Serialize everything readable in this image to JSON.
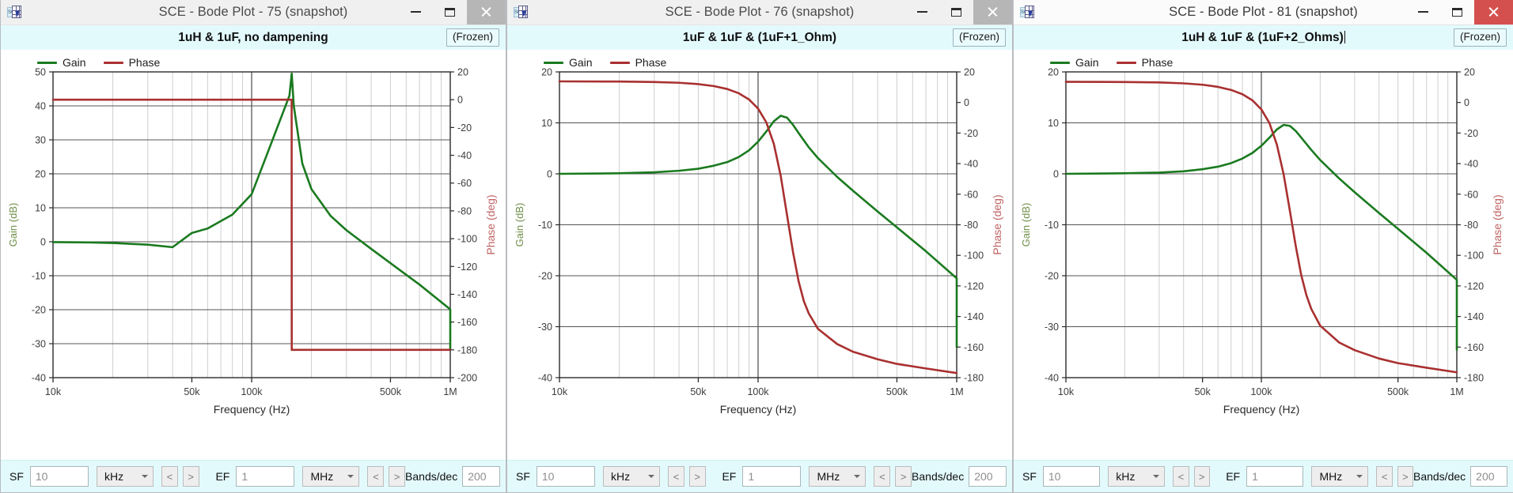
{
  "colors": {
    "gain": "#1a7a1f",
    "phase": "#a93030",
    "gain_axis_label": "#6f8f4a",
    "phase_axis_label": "#c06464",
    "caption_band": "#e3fafd",
    "close_active": "#d4504f",
    "close_inactive": "#b6b6b6",
    "grid_major": "#555555",
    "grid_minor": "#cfcfcf"
  },
  "windows": [
    {
      "id": "window-75",
      "title": "SCE - Bode Plot - 75  (snapshot)",
      "caption": "1uH & 1uF, no dampening",
      "caption_has_caret": false,
      "active": false,
      "frozen_label": "(Frozen)",
      "controls": {
        "minimize": "Minimize",
        "maximize": "Maximize",
        "close": "Close"
      },
      "legend": [
        {
          "label": "Gain",
          "color": "#1a7a1f"
        },
        {
          "label": "Phase",
          "color": "#a93030"
        }
      ],
      "toolbar": {
        "sf_label": "SF",
        "sf_value": "10",
        "sf_unit": "kHz",
        "sf_prev": "<",
        "sf_next": ">",
        "ef_label": "EF",
        "ef_value": "1",
        "ef_unit": "MHz",
        "ef_prev": "<",
        "ef_next": ">",
        "bands_label": "Bands/dec",
        "bands_value": "200"
      },
      "chart_data": {
        "type": "line",
        "title": "1uH & 1uF, no dampening",
        "xlabel": "Frequency (Hz)",
        "ylabel": "Gain (dB)",
        "y2label": "Phase (deg)",
        "xscale": "log",
        "xlim": [
          10000,
          1000000
        ],
        "xticks": [
          10000,
          50000,
          100000,
          500000,
          1000000
        ],
        "xticklabels": [
          "10k",
          "50k",
          "100k",
          "500k",
          "1M"
        ],
        "ylim": [
          -40,
          50
        ],
        "yticks": [
          -40,
          -30,
          -20,
          -10,
          0,
          10,
          20,
          30,
          40,
          50
        ],
        "y2lim": [
          -200,
          20
        ],
        "y2ticks": [
          -200,
          -180,
          -160,
          -140,
          -120,
          -100,
          -80,
          -60,
          -40,
          -20,
          0,
          20
        ],
        "grid": true,
        "legend_position": "top-left",
        "model": {
          "kind": "lc_undamped",
          "L_uH": 1,
          "C_uF": 1,
          "R_ohm": 0
        },
        "series": [
          {
            "name": "Gain",
            "color": "#1a7a1f",
            "axis": "left",
            "points": [
              [
                10000,
                -0.09
              ],
              [
                15000,
                -0.2
              ],
              [
                20000,
                -0.37
              ],
              [
                30000,
                -0.86
              ],
              [
                40000,
                -1.6
              ],
              [
                50000,
                2.6
              ],
              [
                60000,
                3.9
              ],
              [
                80000,
                8.0
              ],
              [
                100000,
                14.0
              ],
              [
                120000,
                26.0
              ],
              [
                155000,
                43.0
              ],
              [
                159155,
                49.5
              ],
              [
                163000,
                40.0
              ],
              [
                180000,
                23.0
              ],
              [
                200000,
                15.5
              ],
              [
                250000,
                7.6
              ],
              [
                300000,
                3.4
              ],
              [
                400000,
                -2.1
              ],
              [
                500000,
                -6.3
              ],
              [
                700000,
                -12.6
              ],
              [
                1000000,
                -19.9
              ],
              [
                1000000,
                -31.5
              ]
            ]
          },
          {
            "name": "Phase",
            "color": "#a93030",
            "axis": "right",
            "points": [
              [
                10000,
                0
              ],
              [
                159000,
                0
              ],
              [
                159200,
                -180
              ],
              [
                1000000,
                -180
              ]
            ]
          }
        ]
      }
    },
    {
      "id": "window-76",
      "title": "SCE - Bode Plot - 76  (snapshot)",
      "caption": "1uF & 1uF & (1uF+1_Ohm)",
      "caption_has_caret": false,
      "active": false,
      "frozen_label": "(Frozen)",
      "controls": {
        "minimize": "Minimize",
        "maximize": "Maximize",
        "close": "Close"
      },
      "legend": [
        {
          "label": "Gain",
          "color": "#1a7a1f"
        },
        {
          "label": "Phase",
          "color": "#a93030"
        }
      ],
      "toolbar": {
        "sf_label": "SF",
        "sf_value": "10",
        "sf_unit": "kHz",
        "sf_prev": "<",
        "sf_next": ">",
        "ef_label": "EF",
        "ef_value": "1",
        "ef_unit": "MHz",
        "ef_prev": "<",
        "ef_next": ">",
        "bands_label": "Bands/dec",
        "bands_value": "200"
      },
      "chart_data": {
        "type": "line",
        "title": "1uF & 1uF & (1uF+1_Ohm)",
        "xlabel": "Frequency (Hz)",
        "ylabel": "Gain (dB)",
        "y2label": "Phase (deg)",
        "xscale": "log",
        "xlim": [
          10000,
          1000000
        ],
        "xticks": [
          10000,
          50000,
          100000,
          500000,
          1000000
        ],
        "xticklabels": [
          "10k",
          "50k",
          "100k",
          "500k",
          "1M"
        ],
        "ylim": [
          -40,
          20
        ],
        "yticks": [
          -40,
          -30,
          -20,
          -10,
          0,
          10,
          20
        ],
        "y2lim": [
          -180,
          20
        ],
        "y2ticks": [
          -180,
          -160,
          -140,
          -120,
          -100,
          -80,
          -60,
          -40,
          -20,
          0,
          20
        ],
        "grid": true,
        "legend_position": "top-left",
        "model": {
          "kind": "lc_damped",
          "L_uH": 1,
          "C_uF": 1,
          "R_ohm": 1
        },
        "series": [
          {
            "name": "Gain",
            "color": "#1a7a1f",
            "axis": "left",
            "points": [
              [
                10000,
                0.0
              ],
              [
                20000,
                0.1
              ],
              [
                30000,
                0.3
              ],
              [
                40000,
                0.6
              ],
              [
                50000,
                1.0
              ],
              [
                60000,
                1.6
              ],
              [
                70000,
                2.3
              ],
              [
                80000,
                3.3
              ],
              [
                90000,
                4.6
              ],
              [
                100000,
                6.3
              ],
              [
                110000,
                8.3
              ],
              [
                120000,
                10.3
              ],
              [
                130000,
                11.4
              ],
              [
                140000,
                11.0
              ],
              [
                150000,
                9.6
              ],
              [
                160000,
                8.0
              ],
              [
                180000,
                5.2
              ],
              [
                200000,
                3.1
              ],
              [
                250000,
                -0.6
              ],
              [
                300000,
                -3.3
              ],
              [
                400000,
                -7.4
              ],
              [
                500000,
                -10.5
              ],
              [
                700000,
                -15.2
              ],
              [
                1000000,
                -20.5
              ],
              [
                1000000,
                -34.0
              ]
            ]
          },
          {
            "name": "Phase",
            "color": "#a93030",
            "axis": "right",
            "points": [
              [
                10000,
                13.8
              ],
              [
                20000,
                13.7
              ],
              [
                30000,
                13.4
              ],
              [
                40000,
                12.9
              ],
              [
                50000,
                12.0
              ],
              [
                60000,
                10.7
              ],
              [
                70000,
                8.8
              ],
              [
                80000,
                6.0
              ],
              [
                90000,
                2.0
              ],
              [
                100000,
                -4.0
              ],
              [
                110000,
                -13.0
              ],
              [
                120000,
                -27.0
              ],
              [
                130000,
                -48.0
              ],
              [
                140000,
                -74.0
              ],
              [
                150000,
                -98.0
              ],
              [
                160000,
                -117.0
              ],
              [
                170000,
                -130.0
              ],
              [
                180000,
                -138.0
              ],
              [
                200000,
                -148.0
              ],
              [
                250000,
                -158.0
              ],
              [
                300000,
                -163.0
              ],
              [
                400000,
                -168.0
              ],
              [
                500000,
                -171.0
              ],
              [
                700000,
                -174.0
              ],
              [
                1000000,
                -177.0
              ]
            ]
          }
        ]
      }
    },
    {
      "id": "window-81",
      "title": "SCE - Bode Plot - 81  (snapshot)",
      "caption": "1uH & 1uF & (1uF+2_Ohms)",
      "caption_has_caret": true,
      "active": true,
      "frozen_label": "(Frozen)",
      "controls": {
        "minimize": "Minimize",
        "maximize": "Maximize",
        "close": "Close"
      },
      "legend": [
        {
          "label": "Gain",
          "color": "#1a7a1f"
        },
        {
          "label": "Phase",
          "color": "#a93030"
        }
      ],
      "toolbar": {
        "sf_label": "SF",
        "sf_value": "10",
        "sf_unit": "kHz",
        "sf_prev": "<",
        "sf_next": ">",
        "ef_label": "EF",
        "ef_value": "1",
        "ef_unit": "MHz",
        "ef_prev": "<",
        "ef_next": ">",
        "bands_label": "Bands/dec",
        "bands_value": "200"
      },
      "chart_data": {
        "type": "line",
        "title": "1uH & 1uF & (1uF+2_Ohms)",
        "xlabel": "Frequency (Hz)",
        "ylabel": "Gain (dB)",
        "y2label": "Phase (deg)",
        "xscale": "log",
        "xlim": [
          10000,
          1000000
        ],
        "xticks": [
          10000,
          50000,
          100000,
          500000,
          1000000
        ],
        "xticklabels": [
          "10k",
          "50k",
          "100k",
          "500k",
          "1M"
        ],
        "ylim": [
          -40,
          20
        ],
        "yticks": [
          -40,
          -30,
          -20,
          -10,
          0,
          10,
          20
        ],
        "y2lim": [
          -180,
          20
        ],
        "y2ticks": [
          -180,
          -160,
          -140,
          -120,
          -100,
          -80,
          -60,
          -40,
          -20,
          0,
          20
        ],
        "grid": true,
        "legend_position": "top-left",
        "model": {
          "kind": "lc_damped",
          "L_uH": 1,
          "C_uF": 1,
          "R_ohm": 2
        },
        "series": [
          {
            "name": "Gain",
            "color": "#1a7a1f",
            "axis": "left",
            "points": [
              [
                10000,
                0.0
              ],
              [
                20000,
                0.1
              ],
              [
                30000,
                0.25
              ],
              [
                40000,
                0.5
              ],
              [
                50000,
                0.9
              ],
              [
                60000,
                1.4
              ],
              [
                70000,
                2.1
              ],
              [
                80000,
                3.0
              ],
              [
                90000,
                4.1
              ],
              [
                100000,
                5.5
              ],
              [
                110000,
                7.1
              ],
              [
                120000,
                8.7
              ],
              [
                130000,
                9.6
              ],
              [
                140000,
                9.4
              ],
              [
                150000,
                8.4
              ],
              [
                160000,
                7.1
              ],
              [
                180000,
                4.7
              ],
              [
                200000,
                2.7
              ],
              [
                250000,
                -0.9
              ],
              [
                300000,
                -3.6
              ],
              [
                400000,
                -7.7
              ],
              [
                500000,
                -10.8
              ],
              [
                700000,
                -15.5
              ],
              [
                1000000,
                -20.8
              ],
              [
                1000000,
                -34.5
              ]
            ]
          },
          {
            "name": "Phase",
            "color": "#a93030",
            "axis": "right",
            "points": [
              [
                10000,
                13.5
              ],
              [
                20000,
                13.4
              ],
              [
                30000,
                13.1
              ],
              [
                40000,
                12.5
              ],
              [
                50000,
                11.6
              ],
              [
                60000,
                10.2
              ],
              [
                70000,
                8.2
              ],
              [
                80000,
                5.4
              ],
              [
                90000,
                1.4
              ],
              [
                100000,
                -4.5
              ],
              [
                110000,
                -13.5
              ],
              [
                120000,
                -27.5
              ],
              [
                130000,
                -47.0
              ],
              [
                140000,
                -71.0
              ],
              [
                150000,
                -94.0
              ],
              [
                160000,
                -113.0
              ],
              [
                170000,
                -126.0
              ],
              [
                180000,
                -135.0
              ],
              [
                200000,
                -146.0
              ],
              [
                250000,
                -157.0
              ],
              [
                300000,
                -162.0
              ],
              [
                400000,
                -167.5
              ],
              [
                500000,
                -170.5
              ],
              [
                700000,
                -173.5
              ],
              [
                1000000,
                -176.5
              ]
            ]
          }
        ]
      }
    }
  ]
}
